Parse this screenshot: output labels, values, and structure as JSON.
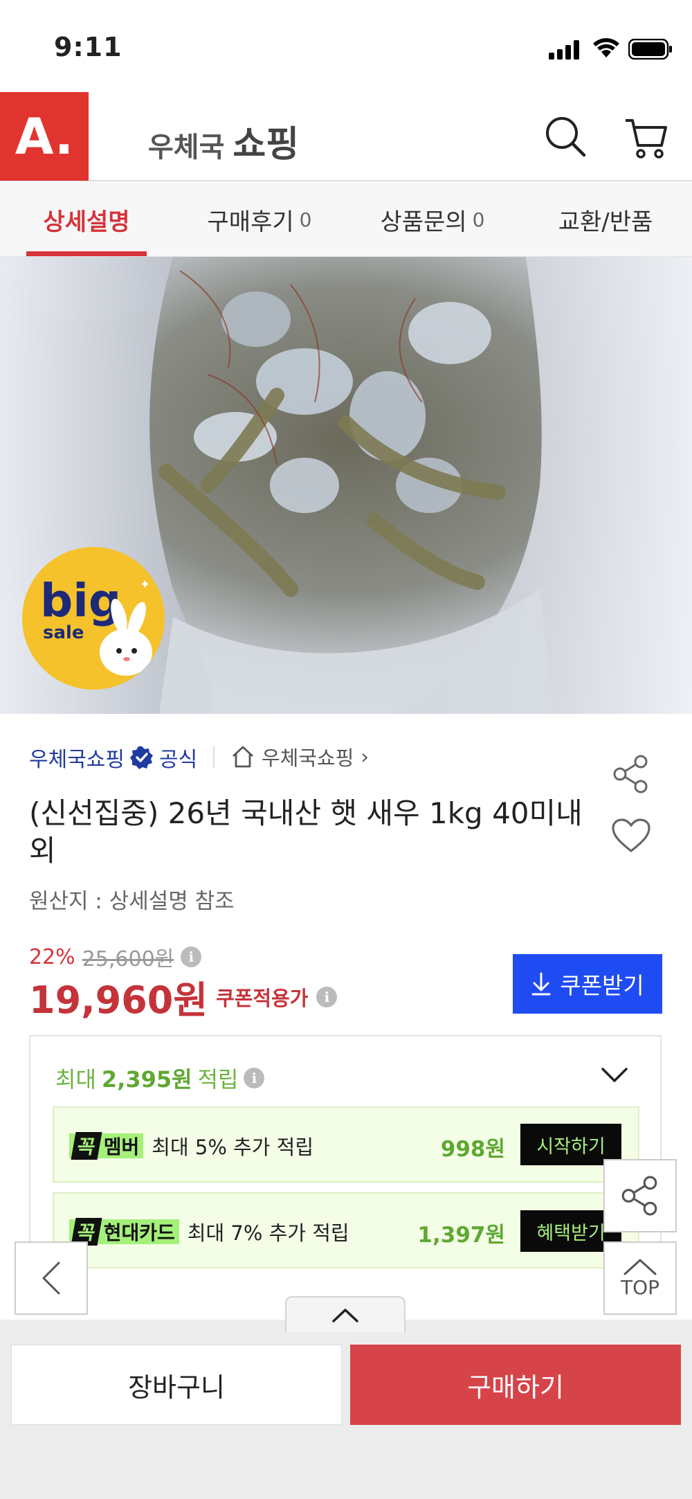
{
  "status_bar": {
    "time": "9:11"
  },
  "header": {
    "logo_text": "A.",
    "brand_prefix": "우체국",
    "brand_main": "쇼핑",
    "icons": [
      "search-icon",
      "cart-icon"
    ]
  },
  "tabs": [
    {
      "label": "상세설명",
      "count": ""
    },
    {
      "label": "구매후기",
      "count": "0"
    },
    {
      "label": "상품문의",
      "count": "0"
    },
    {
      "label": "교환/반품",
      "count": ""
    }
  ],
  "badge": {
    "line1": "big",
    "line2": "sale"
  },
  "seller": {
    "name": "우체국쇼핑",
    "official": "공식"
  },
  "store_link": {
    "label": "우체국쇼핑",
    "chevron": "›"
  },
  "product": {
    "title": "(신선집중) 26년 국내산 햇 새우 1kg 40미내외",
    "origin": "원산지 : 상세설명 참조"
  },
  "price": {
    "discount": "22%",
    "original": "25,600원",
    "final": "19,960원",
    "final_label": "쿠폰적용가"
  },
  "coupon_button": "쿠폰받기",
  "rewards": {
    "prefix": "최대",
    "amount": "2,395원",
    "suffix": "적립",
    "items": [
      {
        "tag_k": "꼭",
        "tag": "멤버",
        "desc": "최대 5% 추가 적립",
        "amount": "998원",
        "button": "시작하기"
      },
      {
        "tag_k": "꼭",
        "tag": "현대카드",
        "desc": "최대 7% 추가 적립",
        "amount": "1,397원",
        "button": "혜택받기"
      }
    ]
  },
  "floating": {
    "top_label": "TOP"
  },
  "bottom": {
    "cart": "장바구니",
    "buy": "구매하기"
  },
  "colors": {
    "accent": "#d6333a",
    "coupon": "#1f4cf2",
    "reward": "#5fa832",
    "seller": "#1f3aa0"
  }
}
